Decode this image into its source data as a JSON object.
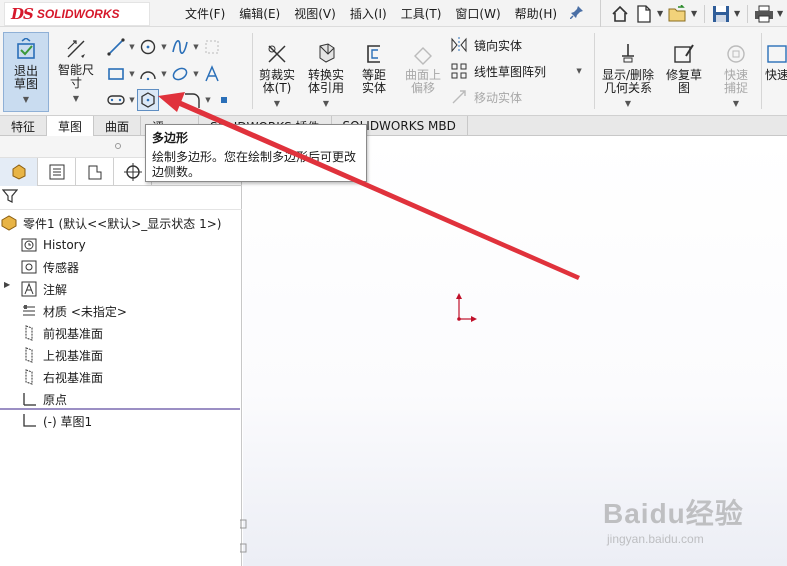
{
  "app": {
    "logo_mark": "DS",
    "logo_text": "SOLIDWORKS"
  },
  "menu": [
    "文件(F)",
    "编辑(E)",
    "视图(V)",
    "插入(I)",
    "工具(T)",
    "窗口(W)",
    "帮助(H)"
  ],
  "ribbon": {
    "exit_sketch": "退出草图",
    "smart_dimension": "智能尺寸",
    "trim": "剪裁实体(T)",
    "convert": "转换实体引用",
    "offset": "等距实体",
    "surface_offset": "曲面上偏移",
    "mirror": "镜向实体",
    "linear_pattern": "线性草图阵列",
    "move": "移动实体",
    "display_relations": "显示/删除几何关系",
    "repair_sketch": "修复草图",
    "quick_snap": "快速捕捉",
    "quick_view": "快速"
  },
  "tabs": [
    "特征",
    "草图",
    "曲面",
    "评",
    "SOLIDWORKS 插件",
    "SOLIDWORKS MBD"
  ],
  "tooltip": {
    "title": "多边形",
    "description": "绘制多边形。您在绘制多边形后可更改边侧数。"
  },
  "tree": {
    "root": "零件1 (默认<<默认>_显示状态 1>)",
    "items": [
      "History",
      "传感器",
      "注解",
      "材质 <未指定>",
      "前视基准面",
      "上视基准面",
      "右视基准面",
      "原点",
      "(-) 草图1"
    ]
  },
  "watermark": {
    "main": "Baidu经验",
    "sub": "jingyan.baidu.com"
  },
  "colors": {
    "accent": "#d6182b",
    "arrow": "#e0323c",
    "highlight": "#c9dcf0"
  }
}
